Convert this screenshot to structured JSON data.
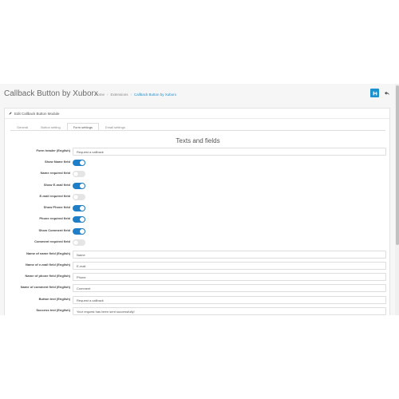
{
  "header": {
    "title": "Callback Button by Xuborx",
    "breadcrumb": [
      "Home",
      "Extensions",
      "Callback Button by Xuborx"
    ],
    "save_icon": "save-icon",
    "back_icon": "reply-icon"
  },
  "panel": {
    "title": "Edit Callback Button Module",
    "title_icon": "pencil-icon"
  },
  "tabs": [
    {
      "label": "General",
      "active": false
    },
    {
      "label": "Button setting",
      "active": false
    },
    {
      "label": "Form settings",
      "active": true
    },
    {
      "label": "Email settings",
      "active": false
    }
  ],
  "section_title": "Texts and fields",
  "fields": [
    {
      "label": "Form header (English)",
      "type": "text",
      "value": "Request a callback"
    },
    {
      "label": "Show Name field",
      "type": "toggle",
      "on": true
    },
    {
      "label": "Name required field",
      "type": "toggle",
      "on": false
    },
    {
      "label": "Show E-mail field",
      "type": "toggle",
      "on": true
    },
    {
      "label": "E-mail required field",
      "type": "toggle",
      "on": false
    },
    {
      "label": "Show Phone field",
      "type": "toggle",
      "on": true
    },
    {
      "label": "Phone required field",
      "type": "toggle",
      "on": true
    },
    {
      "label": "Show Comment field",
      "type": "toggle",
      "on": true
    },
    {
      "label": "Comment required field",
      "type": "toggle",
      "on": false
    },
    {
      "label": "Name of name field (English)",
      "type": "text",
      "value": "Name"
    },
    {
      "label": "Name of e-mail field (English)",
      "type": "text",
      "value": "E-mail"
    },
    {
      "label": "Name of phone field (English)",
      "type": "text",
      "value": "Phone"
    },
    {
      "label": "Name of comment field (English)",
      "type": "text",
      "value": "Comment"
    },
    {
      "label": "Button text (English)",
      "type": "text",
      "value": "Request a callback"
    },
    {
      "label": "Success text (English)",
      "type": "text",
      "value": "Your request has been sent successfully!"
    }
  ],
  "colors": {
    "accent": "#1e91cf",
    "toggle_on": "#1e7fc8",
    "toggle_off": "#e5e5e5"
  }
}
